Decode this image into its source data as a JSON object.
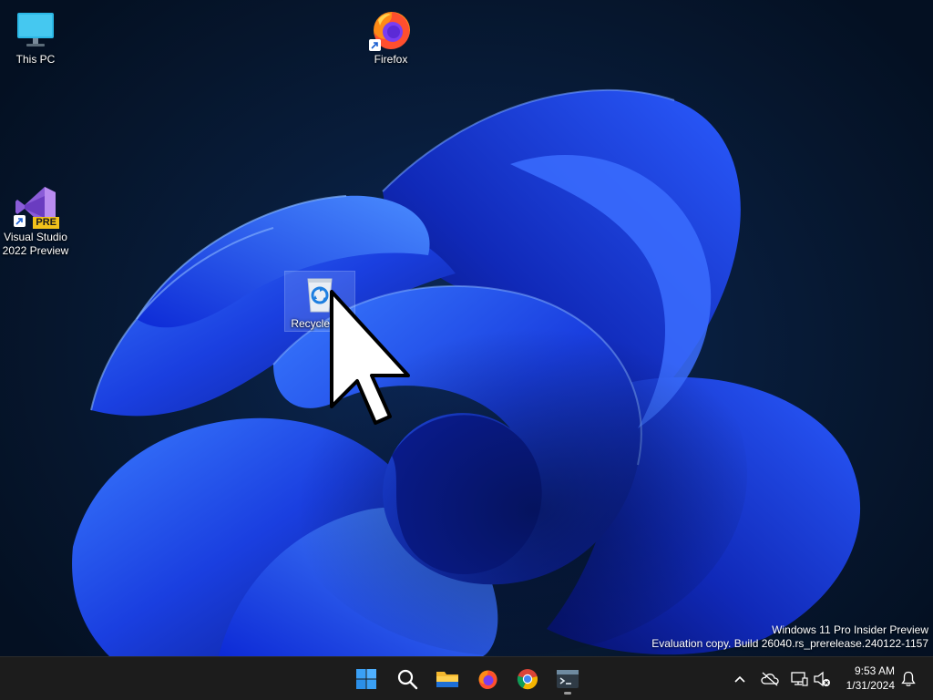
{
  "desktop": {
    "icons": [
      {
        "label": "This PC",
        "icon": "monitor-icon"
      },
      {
        "label": "Firefox",
        "icon": "firefox-icon"
      },
      {
        "label": "Visual Studio 2022 Preview",
        "icon": "visual-studio-preview-icon",
        "badge": "PRE"
      },
      {
        "label": "Recycle Bin",
        "icon": "recycle-bin-icon",
        "selected": true
      }
    ],
    "watermark": {
      "line1": "Windows 11 Pro Insider Preview",
      "line2": "Evaluation copy. Build 26040.rs_prerelease.240122-1157"
    }
  },
  "taskbar": {
    "apps": [
      {
        "name": "Start",
        "icon": "windows-logo-icon"
      },
      {
        "name": "Search",
        "icon": "search-icon"
      },
      {
        "name": "File Explorer",
        "icon": "folder-icon"
      },
      {
        "name": "Firefox",
        "icon": "firefox-icon"
      },
      {
        "name": "Google Chrome",
        "icon": "chrome-icon"
      },
      {
        "name": "Terminal",
        "icon": "terminal-icon",
        "running": true
      }
    ],
    "tray": {
      "icons": [
        "chevron-up-icon",
        "cloud-offline-icon",
        "network-icon",
        "speaker-muted-icon",
        "notification-bell-icon"
      ],
      "time": "9:53 AM",
      "date": "1/31/2024"
    }
  },
  "colors": {
    "wallpaper_background": "#071528",
    "bloom_blue": "#1f4fff",
    "taskbar": "#1c1c1c",
    "windows_logo": "#3aa0f5"
  }
}
